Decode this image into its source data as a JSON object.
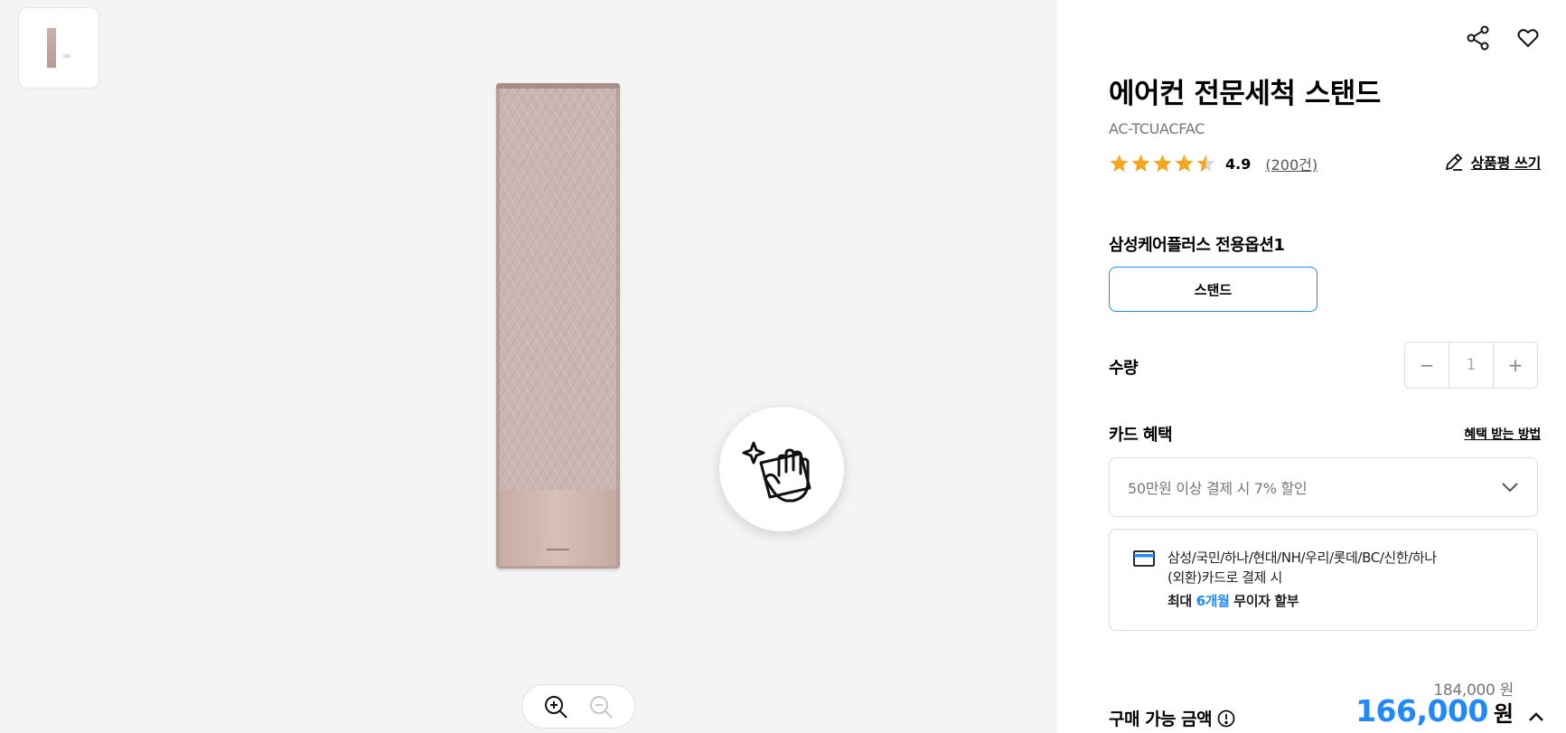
{
  "product": {
    "title": "에어컨 전문세척 스탠드",
    "model": "AC-TCUACFAC",
    "rating": "4.9",
    "rating_value": 4.5,
    "rating_max": 5,
    "review_count": "(200건)",
    "write_review": "상품평 쓰기"
  },
  "option": {
    "label": "삼성케어플러스 전용옵션1",
    "selected": "스탠드"
  },
  "quantity": {
    "label": "수량",
    "minus": "−",
    "value": "1",
    "plus": "+"
  },
  "card_benefit": {
    "label": "카드 혜택",
    "how_link": "혜택 받는 방법",
    "select_text": "50만원 이상 결제 시 7% 할인",
    "line1": "삼성/국민/하나/현대/NH/우리/롯데/BC/신한/하나",
    "line2": "(외환)카드로 결제 시",
    "line3_prefix": "최대 ",
    "line3_accent": "6개월",
    "line3_suffix": " 무이자 할부"
  },
  "price": {
    "original": "184,000 원",
    "label": "구매 가능 금액",
    "final": "166,000",
    "currency": "원"
  },
  "colors": {
    "accent": "#2189ff",
    "star": "#f5a623"
  },
  "icons": [
    "share-icon",
    "heart-icon",
    "pencil-icon",
    "chevron-down-icon",
    "card-icon",
    "info-icon",
    "chevron-up-icon",
    "zoom-in-icon",
    "zoom-out-icon",
    "cleaning-hand-icon"
  ]
}
